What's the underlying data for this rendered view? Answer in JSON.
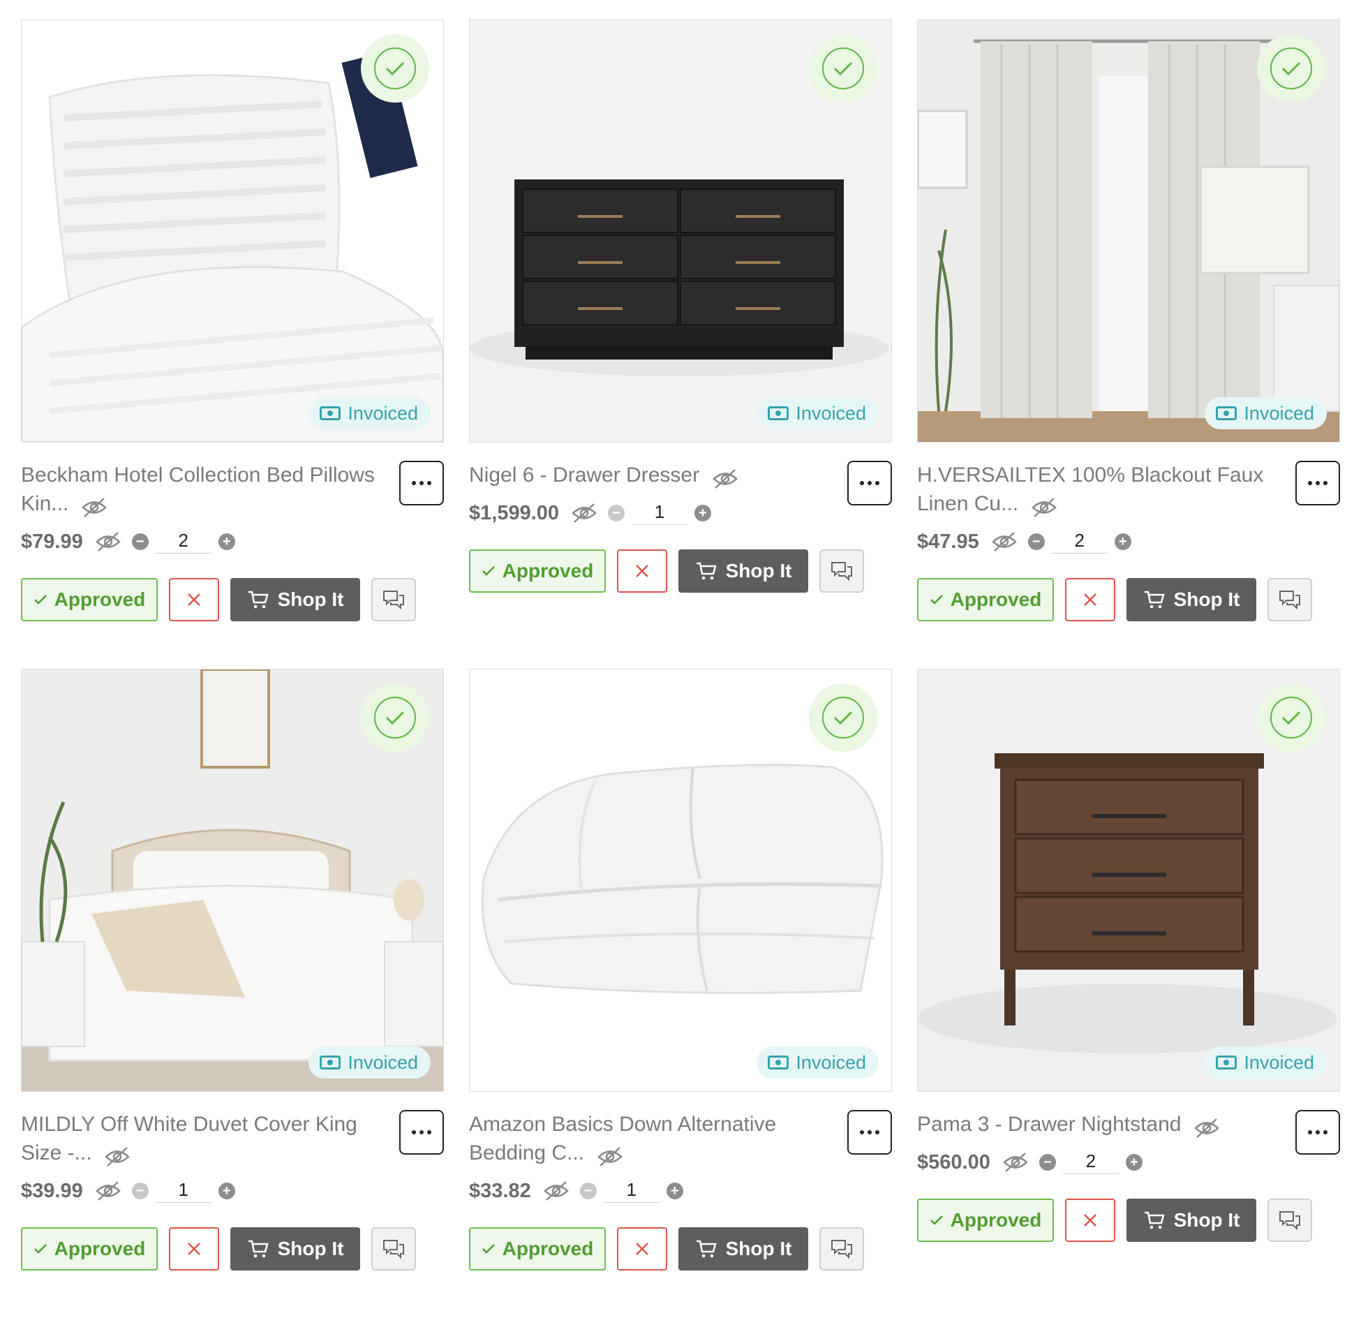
{
  "status_labels": {
    "invoiced": "Invoiced",
    "approved": "Approved",
    "shop": "Shop It"
  },
  "colors": {
    "approved_green": "#6cc04a",
    "invoiced_teal": "#35a3ad",
    "reject_red": "#e0534b",
    "shop_gray": "#5e5e5e"
  },
  "products": [
    {
      "title": "Beckham Hotel Collection Bed Pillows Kin...",
      "price": "$79.99",
      "quantity": "2",
      "image": "white-pillows"
    },
    {
      "title": "Nigel 6 - Drawer Dresser",
      "price": "$1,599.00",
      "quantity": "1",
      "image": "black-dresser"
    },
    {
      "title": "H.VERSAILTEX 100% Blackout Faux Linen Cu...",
      "price": "$47.95",
      "quantity": "2",
      "image": "linen-curtains"
    },
    {
      "title": "MILDLY Off White Duvet Cover King Size -...",
      "price": "$39.99",
      "quantity": "1",
      "image": "bedroom-duvet"
    },
    {
      "title": "Amazon Basics Down Alternative Bedding C...",
      "price": "$33.82",
      "quantity": "1",
      "image": "folded-comforter"
    },
    {
      "title": "Pama 3 - Drawer Nightstand",
      "price": "$560.00",
      "quantity": "2",
      "image": "wood-nightstand"
    }
  ]
}
